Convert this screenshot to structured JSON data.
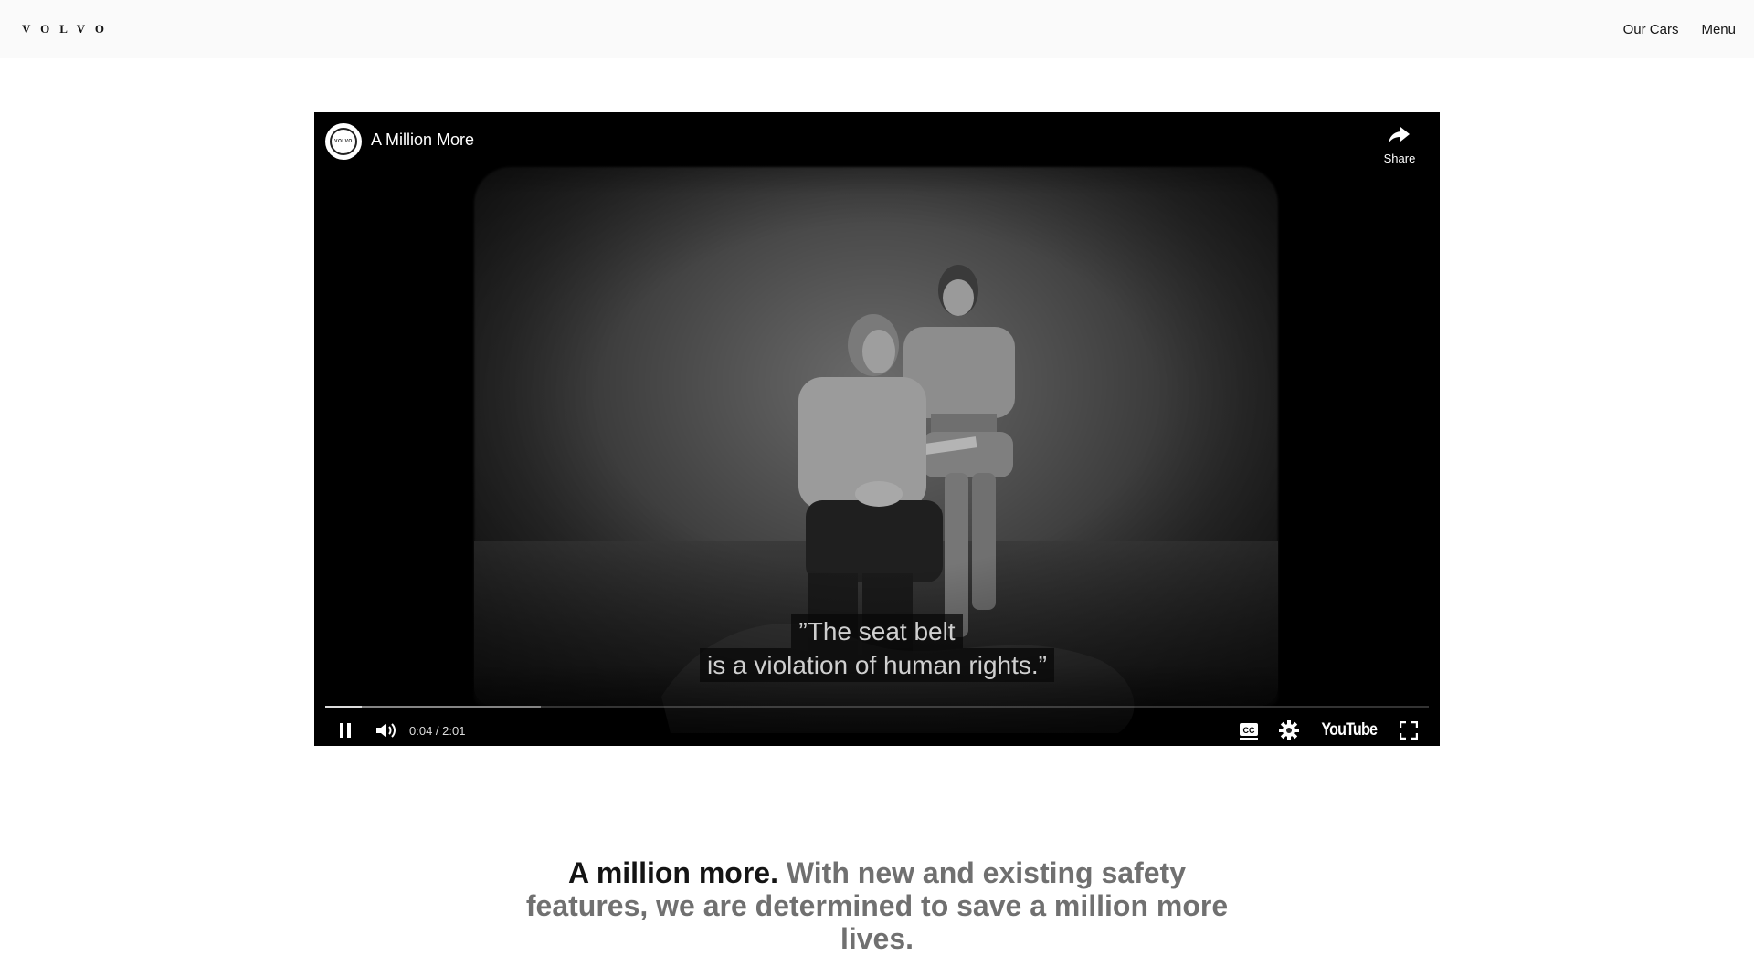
{
  "header": {
    "logo_text": "VOLVO",
    "nav": {
      "our_cars": "Our Cars",
      "menu": "Menu"
    }
  },
  "video": {
    "channel_avatar_text": "VOLVO",
    "title": "A Million More",
    "share_label": "Share",
    "caption_lines": [
      "”The seat belt",
      "is a violation of human rights.”"
    ],
    "current_time": "0:04",
    "duration": "2:01",
    "time_display": "0:04 / 2:01",
    "progress_played_fraction": 0.033,
    "progress_loaded_fraction": 0.195,
    "playing": true,
    "icons": [
      "volvo-logo-icon",
      "share-icon",
      "pause-icon",
      "volume-icon",
      "cc-icon",
      "settings-icon",
      "youtube-logo",
      "fullscreen-icon"
    ],
    "youtube_label": "YouTube"
  },
  "tagline": {
    "strong": "A million more.",
    "rest": " With new and existing safety features, we are determined to save a million more lives."
  },
  "colors": {
    "header_bg": "#fafafa",
    "text_dark": "#141414",
    "text_muted": "#707070",
    "player_bg": "#000000"
  }
}
